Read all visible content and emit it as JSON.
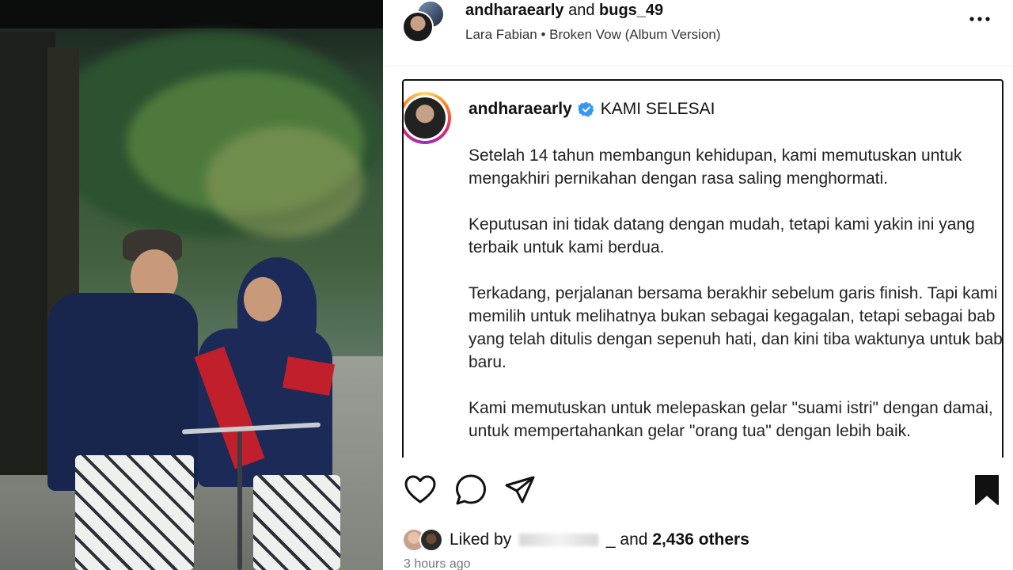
{
  "header": {
    "user1": "andharaearly",
    "connector": "and",
    "user2": "bugs_49",
    "artist": "Lara Fabian",
    "separator": "•",
    "song": "Broken Vow (Album Version)"
  },
  "post_card": {
    "username": "andharaearly",
    "title": "KAMI SELESAI",
    "paragraphs": [
      "Setelah 14 tahun membangun kehidupan, kami memutuskan untuk mengakhiri pernikahan dengan rasa saling menghormati.",
      "Keputusan ini tidak datang dengan mudah, tetapi kami yakin ini yang terbaik untuk kami berdua.",
      "Terkadang, perjalanan bersama berakhir sebelum garis finish. Tapi kami memilih untuk melihatnya bukan sebagai kegagalan, tetapi sebagai bab yang telah ditulis dengan sepenuh hati, dan kini tiba waktunya untuk bab baru.",
      "Kami memutuskan untuk melepaskan gelar \"suami istri\" dengan damai, untuk mempertahankan gelar \"orang tua\" dengan lebih baik."
    ]
  },
  "likes": {
    "prefix": "Liked by",
    "connector": "_ and",
    "count": "2,436 others"
  },
  "timestamp": "3 hours ago",
  "icons": {
    "like": "heart-icon",
    "comment": "comment-icon",
    "share": "send-icon",
    "save": "bookmark-icon",
    "more": "more-options-icon",
    "verified": "verified-badge-icon"
  },
  "colors": {
    "verified": "#3897f0",
    "story_ring": [
      "#feda75",
      "#fa7e1e",
      "#d62976",
      "#962fbf"
    ]
  }
}
